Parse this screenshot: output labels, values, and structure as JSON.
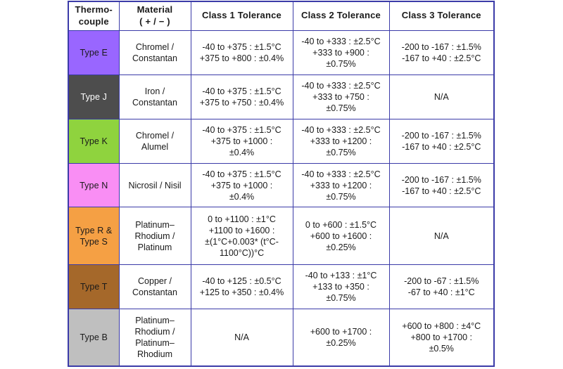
{
  "table": {
    "headers": [
      {
        "line1": "Thermo-",
        "line2": "couple"
      },
      {
        "line1": "Material",
        "line2": "( + / − )"
      },
      {
        "line1": "Class 1 Tolerance",
        "line2": ""
      },
      {
        "line1": "Class 2 Tolerance",
        "line2": ""
      },
      {
        "line1": "Class 3 Tolerance",
        "line2": ""
      }
    ],
    "rows": [
      {
        "type": "Type E",
        "type_bg": "#9966ff",
        "type_fg": "#1a1a1a",
        "material": "Chromel /\nConstantan",
        "class1": "-40 to +375 : ±1.5°C\n+375 to +800 : ±0.4%",
        "class2": "-40 to +333 : ±2.5°C\n+333 to +900 :\n±0.75%",
        "class3": "-200 to -167 : ±1.5%\n-167 to +40 : ±2.5°C"
      },
      {
        "type": "Type J",
        "type_bg": "#4d4d4d",
        "type_fg": "#ffffff",
        "material": "Iron /\nConstantan",
        "class1": "-40 to +375 : ±1.5°C\n+375 to +750 : ±0.4%",
        "class2": "-40 to +333 : ±2.5°C\n+333 to +750 :\n±0.75%",
        "class3": "N/A"
      },
      {
        "type": "Type K",
        "type_bg": "#8fd33e",
        "type_fg": "#1a1a1a",
        "material": "Chromel /\nAlumel",
        "class1": "-40 to +375 : ±1.5°C\n+375 to +1000 :\n±0.4%",
        "class2": "-40 to +333 : ±2.5°C\n+333 to +1200 :\n±0.75%",
        "class3": "-200 to -167 : ±1.5%\n-167 to +40 : ±2.5°C"
      },
      {
        "type": "Type N",
        "type_bg": "#f98ef4",
        "type_fg": "#1a1a1a",
        "material": "Nicrosil / Nisil",
        "class1": "-40 to +375 : ±1.5°C\n+375 to +1000 :\n±0.4%",
        "class2": "-40 to +333 : ±2.5°C\n+333 to +1200 :\n±0.75%",
        "class3": "-200 to -167 : ±1.5%\n-167 to +40 : ±2.5°C"
      },
      {
        "type": "Type R &\nType S",
        "type_bg": "#f5a044",
        "type_fg": "#1a1a1a",
        "material": "Platinum–\nRhodium /\nPlatinum",
        "class1": "0 to +1100 : ±1°C\n+1100 to +1600 :\n±(1°C+0.003* (t°C-\n1100°C))°C",
        "class2": "0 to +600 : ±1.5°C\n+600 to +1600 :\n±0.25%",
        "class3": "N/A"
      },
      {
        "type": "Type T",
        "type_bg": "#a5682a",
        "type_fg": "#1a1a1a",
        "material": "Copper /\nConstantan",
        "class1": "-40 to +125 : ±0.5°C\n+125 to +350 : ±0.4%",
        "class2": "-40 to +133 : ±1°C\n+133 to +350 :\n±0.75%",
        "class3": "-200 to -67 : ±1.5%\n-67 to +40 : ±1°C"
      },
      {
        "type": "Type B",
        "type_bg": "#bfbfbf",
        "type_fg": "#1a1a1a",
        "material": "Platinum–\nRhodium /\nPlatinum–\nRhodium",
        "class1": "N/A",
        "class2": "+600 to +1700 :\n±0.25%",
        "class3": "+600 to +800 : ±4°C\n+800 to +1700 :\n±0.5%"
      }
    ]
  },
  "style": {
    "border_color": "#3b3ba8",
    "background": "#ffffff",
    "text_color": "#1a1a1a"
  }
}
